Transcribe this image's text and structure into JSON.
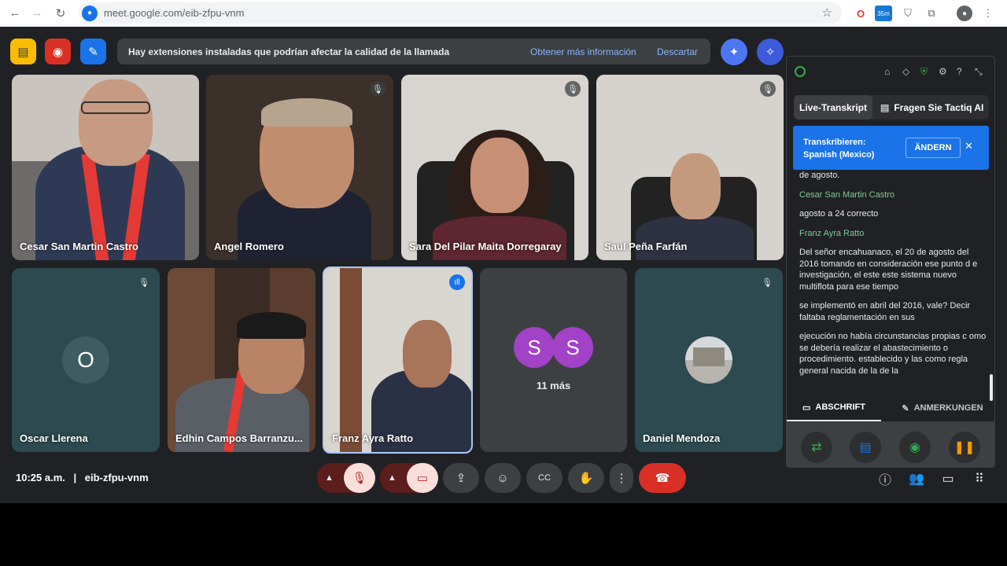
{
  "browser": {
    "url": "meet.google.com/eib-zfpu-vnm",
    "badge_35m": "35m"
  },
  "banner": {
    "text": "Hay extensiones instaladas que podrían afectar la calidad de la llamada",
    "more_info": "Obtener más información",
    "dismiss": "Descartar"
  },
  "participants": {
    "p1": "Cesar San Martin Castro",
    "p2": "Angel Romero",
    "p3": "Sara Del Pilar Maita Dorregaray",
    "p4": "Saul Peña Farfán",
    "p5": "Oscar Llerena",
    "p5_initial": "O",
    "p6": "Edhin Campos Barranzu...",
    "p7": "Franz Ayra Ratto",
    "p8_avatar1": "S",
    "p8_avatar2": "S",
    "p8_more": "11 más",
    "p9": "Daniel Mendoza"
  },
  "meeting": {
    "time": "10:25 a.m.",
    "separator": "|",
    "code": "eib-zfpu-vnm"
  },
  "tactiq": {
    "tab_live": "Live-Transkript",
    "tab_ai": "Fragen Sie Tactiq AI",
    "transcribe_label": "Transkribieren:",
    "language": "Spanish (Mexico)",
    "change_button": "ÄNDERN",
    "transcript": [
      {
        "text": "de agosto."
      },
      {
        "speaker": "Cesar San Martin Castro"
      },
      {
        "text": "agosto a 24 correcto"
      },
      {
        "speaker": "Franz Ayra Ratto"
      },
      {
        "text": "Del señor encahuanaco, el 20 de agosto del 2016 tomando en consideración ese punto d e investigación, el este este sistema nuevo multiflota para ese tiempo"
      },
      {
        "text": "se implementó en abril del 2016, vale? Decir faltaba reglamentación en sus"
      },
      {
        "text": "ejecución no había circunstancias propias c omo se debería realizar el abastecimiento o procedimiento. establecido y las como regla general nacida de la de la"
      }
    ],
    "subtab_transcript": "ABSCHRIFT",
    "subtab_notes": "ANMERKUNGEN"
  },
  "colors": {
    "meet_bg": "#202124",
    "accent_blue": "#1a73e8",
    "speaker_green": "#81c995",
    "end_call_red": "#d93025"
  }
}
